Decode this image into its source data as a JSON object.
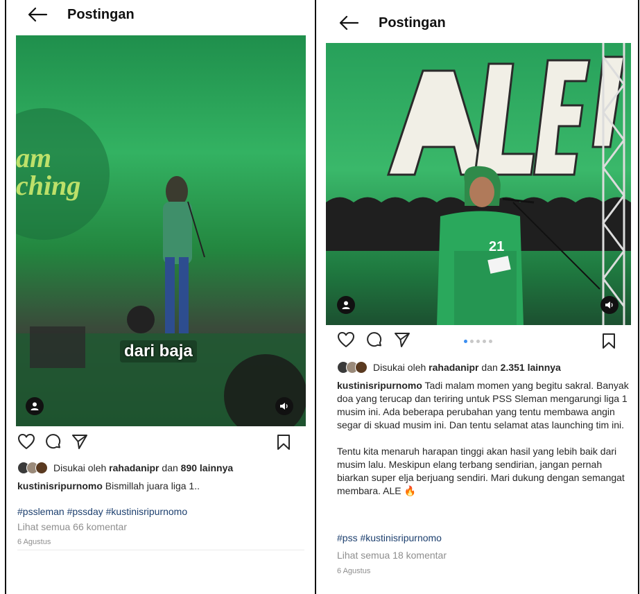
{
  "left_post": {
    "header_title": "Postingan",
    "subtitle": "dari baja",
    "likes_prefix": "Disukai oleh",
    "liked_by": "rahadanipr",
    "likes_mid": "dan",
    "likes_count": "890 lainnya",
    "username": "kustinisripurnomo",
    "caption": "Bismillah juara liga 1..",
    "hashtags": "#pssleman #pssday #kustinisripurnomo",
    "comments_link": "Lihat semua 66 komentar",
    "date": "6 Agustus"
  },
  "right_post": {
    "header_title": "Postingan",
    "likes_prefix": "Disukai oleh",
    "liked_by": "rahadanipr",
    "likes_mid": "dan",
    "likes_count": "2.351 lainnya",
    "username": "kustinisripurnomo",
    "caption_p1": "Tadi malam momen yang begitu sakral. Banyak doa yang terucap dan teriring untuk PSS Sleman mengarungi liga 1 musim ini. Ada beberapa perubahan yang tentu membawa angin segar di skuad musim ini. Dan tentu selamat atas launching tim ini.",
    "caption_p2": "Tentu kita menaruh harapan tinggi akan hasil yang lebih baik dari musim lalu. Meskipun elang terbang sendirian, jangan pernah biarkan super elja berjuang sendiri. Mari dukung dengan semangat membara. ALE 🔥",
    "hashtags": "#pss #kustinisripurnomo",
    "comments_link": "Lihat semua 18 komentar",
    "date": "6 Agustus",
    "carousel": {
      "count": 5,
      "active_index": 0
    }
  },
  "icons": [
    "back-arrow-icon",
    "heart-icon",
    "comment-icon",
    "share-icon",
    "bookmark-icon",
    "user-tag-icon",
    "volume-icon"
  ],
  "colors": {
    "hashtag": "#1c3f6e",
    "muted": "#8e8e8e",
    "carousel_active": "#3b8ef0",
    "media_green": "#2fa85c"
  }
}
